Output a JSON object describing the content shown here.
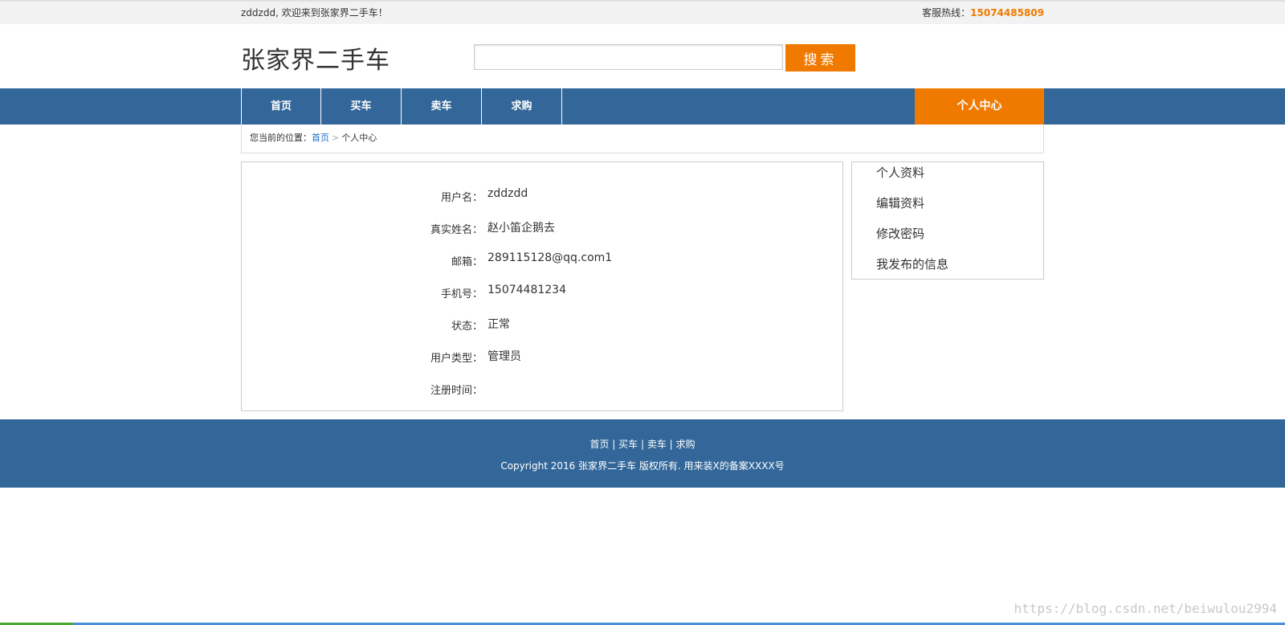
{
  "topbar": {
    "welcome": "zddzdd, 欢迎来到张家界二手车！",
    "hotline_label": "客服热线：",
    "hotline_number": "15074485809"
  },
  "header": {
    "logo": "张家界二手车",
    "search_value": "",
    "search_button": "搜索"
  },
  "nav": {
    "items": [
      "首页",
      "买车",
      "卖车",
      "求购"
    ],
    "personal_center": "个人中心"
  },
  "breadcrumb": {
    "prefix": "您当前的位置：",
    "home": "首页",
    "separator": ">",
    "current": "个人中心"
  },
  "profile": {
    "rows": [
      {
        "label": "用户名：",
        "value": "zddzdd"
      },
      {
        "label": "真实姓名：",
        "value": "赵小笛企鹅去"
      },
      {
        "label": "邮箱：",
        "value": "289115128@qq.com1"
      },
      {
        "label": "手机号：",
        "value": "15074481234"
      },
      {
        "label": "状态：",
        "value": "正常"
      },
      {
        "label": "用户类型：",
        "value": "管理员"
      },
      {
        "label": "注册时间：",
        "value": ""
      }
    ]
  },
  "side_menu": {
    "items": [
      "个人资料",
      "编辑资料",
      "修改密码",
      "我发布的信息"
    ]
  },
  "footer": {
    "links": [
      "首页",
      "买车",
      "卖车",
      "求购"
    ],
    "link_separator": " | ",
    "copyright": "Copyright 2016 张家界二手车 版权所有. 用来装X的备案XXXX号"
  },
  "watermark": "https://blog.csdn.net/beiwulou2994",
  "colors": {
    "nav_blue": "#336799",
    "accent_orange": "#f07a00",
    "link_blue": "#1a6fc4"
  }
}
